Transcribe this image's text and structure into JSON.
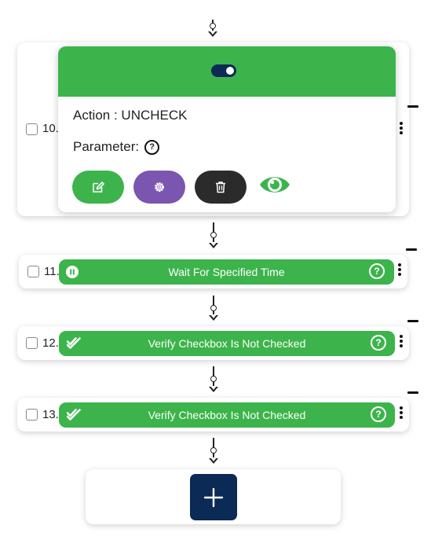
{
  "colors": {
    "accent_green": "#3cb44b",
    "navy": "#0b2a55",
    "delete_dark": "#2b2b2b",
    "settings_purple": "#7a56b0"
  },
  "steps": [
    {
      "number": "10.",
      "expanded": true,
      "action_line": "Action : UNCHECK",
      "parameter_label": "Parameter:",
      "help_symbol": "?",
      "icons": [
        "toggle-switch",
        "edit-icon",
        "settings-gear-icon",
        "trash-icon",
        "eye-icon"
      ]
    },
    {
      "number": "11.",
      "title": "Wait For Specified Time",
      "icon": "pause-icon",
      "help_symbol": "?"
    },
    {
      "number": "12.",
      "title": "Verify Checkbox Is Not Checked",
      "icon": "double-check-icon",
      "help_symbol": "?"
    },
    {
      "number": "13.",
      "title": "Verify Checkbox Is Not Checked",
      "icon": "double-check-icon",
      "help_symbol": "?"
    }
  ],
  "add_step": {
    "icon": "plus-icon"
  }
}
